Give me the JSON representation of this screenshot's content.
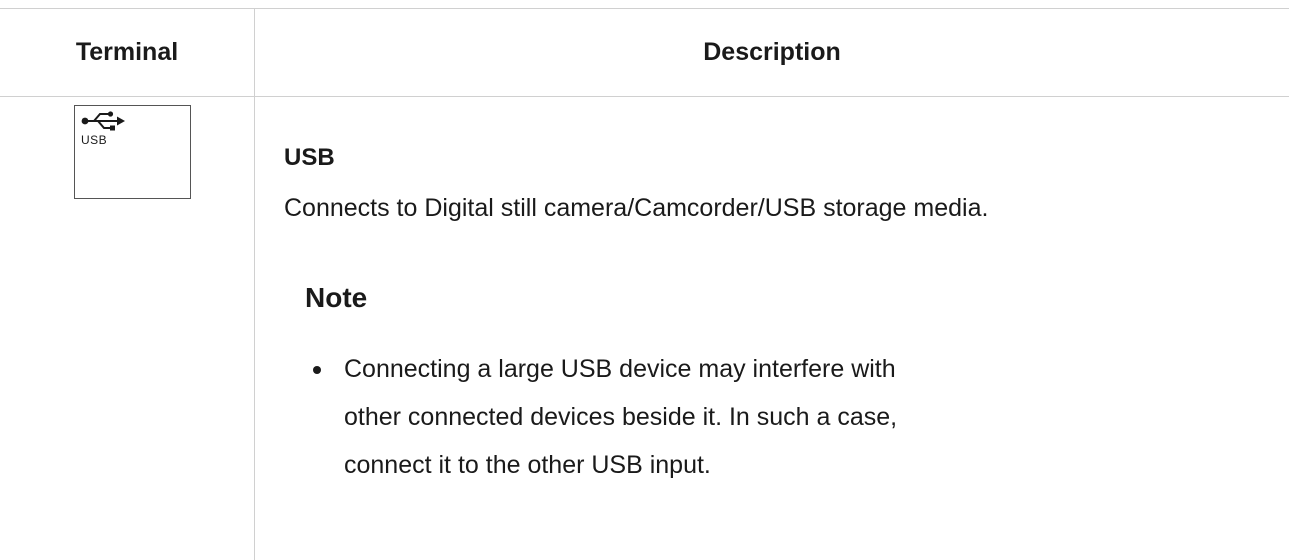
{
  "table": {
    "headers": {
      "terminal": "Terminal",
      "description": "Description"
    },
    "rows": [
      {
        "terminal": {
          "icon": "usb-icon",
          "label": "USB"
        },
        "title": "USB",
        "text": "Connects to Digital still camera/Camcorder/USB storage media.",
        "note": {
          "title": "Note",
          "items": [
            "Connecting a large USB device may interfere with other connected devices beside it. In such a case, connect it to the other USB input."
          ]
        }
      }
    ]
  }
}
